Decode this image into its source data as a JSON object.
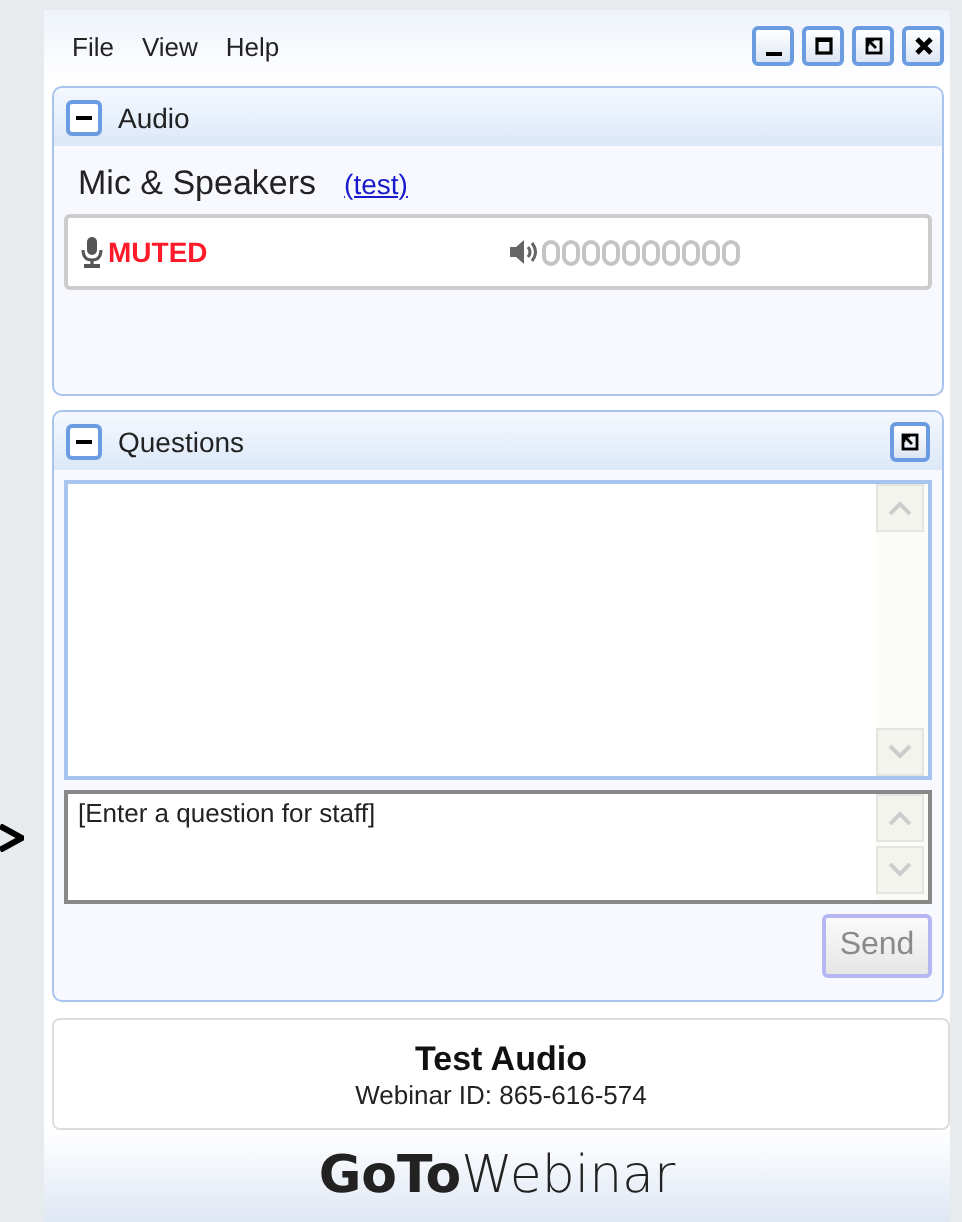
{
  "menu": [
    "File",
    "View",
    "Help"
  ],
  "window_controls": [
    {
      "kind": "minimize"
    },
    {
      "kind": "maximize"
    },
    {
      "kind": "popout"
    },
    {
      "kind": "close"
    }
  ],
  "audio": {
    "title": "Audio",
    "expanded": true,
    "mode": "Mic & Speakers",
    "test_link": "(test)",
    "mic_status": "MUTED"
  },
  "questions": {
    "title": "Questions",
    "expanded": true,
    "placeholder": "[Enter a question for staff]",
    "send": {
      "label": "Send",
      "disabled": true
    }
  },
  "info": {
    "title": "Test Audio",
    "webinar_id": "Webinar ID: 865-616-574"
  },
  "logo": {
    "bold": "GoTo",
    "light": "Webinar"
  }
}
